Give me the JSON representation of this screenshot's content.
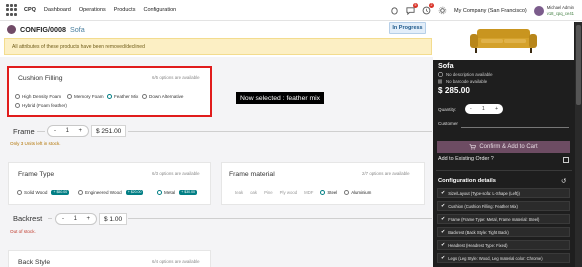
{
  "nav": {
    "app": "CPQ",
    "items": [
      "Dashboard",
      "Operations",
      "Products",
      "Configuration"
    ],
    "badges": [
      "5",
      "2"
    ],
    "company": "My Company (San Francisco)",
    "user_name": "Michael Admin",
    "user_db": "v18_cpq_ce41"
  },
  "breadcrumb": {
    "code": "CONFIG/0008",
    "name": "Sofa",
    "status": "In Progress"
  },
  "warning": "All attributes of these products have been removed/declined",
  "cushion": {
    "title": "Cushion Filling",
    "count": "6/5 options are available",
    "options": [
      {
        "label": "High Density Foam",
        "selected": false
      },
      {
        "label": "Memory Foam",
        "selected": false
      },
      {
        "label": "Feather Mix",
        "selected": true
      },
      {
        "label": "Down Alternative",
        "selected": false
      },
      {
        "label": "Hybrid (Foam feather)",
        "selected": false
      }
    ]
  },
  "annotation": "Now selected : feather mix",
  "frame": {
    "title": "Frame",
    "qty": "1",
    "price": "$ 251.00",
    "stock": "Only 3 Units left in stock."
  },
  "frame_type": {
    "title": "Frame Type",
    "count": "6/3 options are available",
    "options": [
      {
        "label": "Solid Wood",
        "tag": "+ $50.00",
        "selected": false
      },
      {
        "label": "Engineered Wood",
        "tag": "+ $20.00",
        "selected": false
      },
      {
        "label": "Metal",
        "tag": "+ $30.00",
        "selected": true
      }
    ]
  },
  "frame_material": {
    "title": "Frame material",
    "count": "2/7 options are available",
    "options": [
      {
        "label": "teak",
        "selected": false
      },
      {
        "label": "oak",
        "selected": false
      },
      {
        "label": "Pine",
        "selected": false
      },
      {
        "label": "Ply wood",
        "selected": false
      },
      {
        "label": "MDF",
        "selected": false
      },
      {
        "label": "Steel",
        "selected": true
      },
      {
        "label": "Aluminium",
        "selected": false
      }
    ]
  },
  "backrest": {
    "title": "Backrest",
    "qty": "1",
    "price": "$ 1.00",
    "stock": "Out of stock."
  },
  "back_style": {
    "title": "Back Style",
    "count": "6/4 options are available"
  },
  "summary": {
    "product": "Sofa",
    "desc": "No description available",
    "barcode": "No barcode available",
    "price": "$ 285.00",
    "quantity_label": "Quantity:",
    "qty": "1",
    "customer_label": "Customer",
    "cta": "Confirm & Add to Cart",
    "existing_order": "Add to Existing Order ?",
    "config_title": "Configuration details",
    "details": [
      "Size/Layout (Type-sofa: L-Shape (Left))",
      "Cushion (Cushion Filling: Feather Mix)",
      "Frame (Frame Type: Metal, Frame material: Steel)",
      "Backrest (Back Style: Tight Back)",
      "Headrest (Headrest Type: Fixed)",
      "Legs (Leg Style: Wood, Leg material color: Chrome)"
    ]
  },
  "colors": {
    "accent": "#714b67",
    "teal": "#017e84",
    "highlight": "#e11c1c"
  }
}
